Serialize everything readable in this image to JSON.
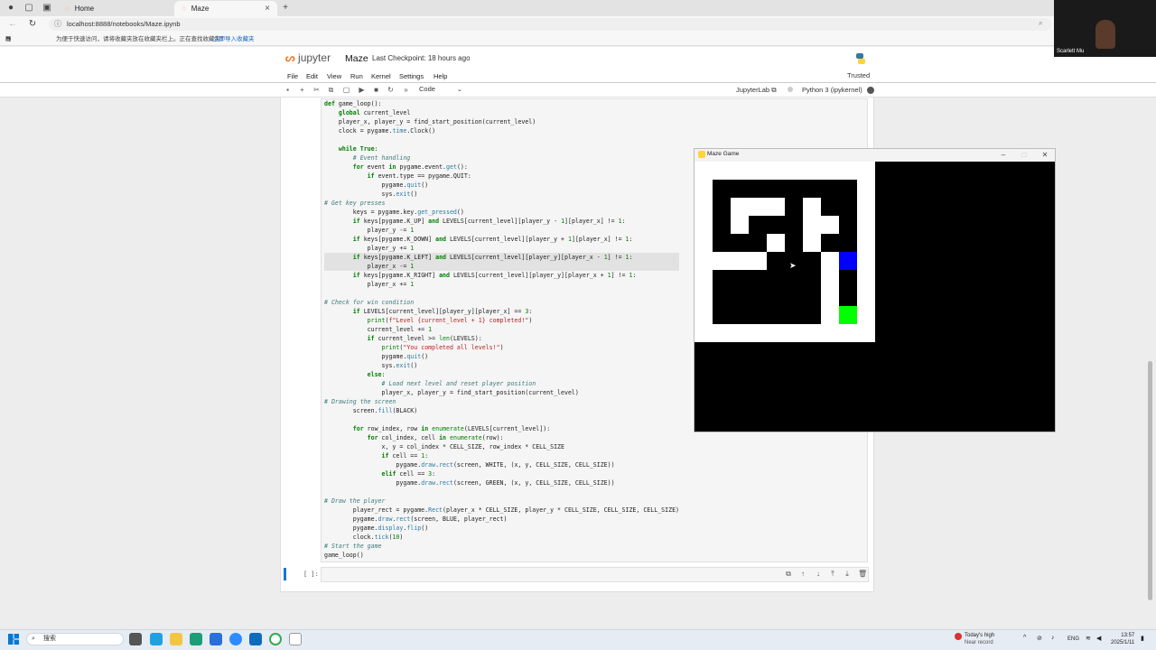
{
  "browser": {
    "tabs": [
      {
        "label": "Home"
      },
      {
        "label": "Maze"
      }
    ],
    "url": "localhost:8888/notebooks/Maze.ipynb",
    "bookmarks": {
      "import": "导入收藏夹",
      "hint": "为便于快速访问，请将收藏夹放在收藏夹栏上。正在查找收藏夹?",
      "link": "立即导入收藏夹"
    }
  },
  "jupyter": {
    "logo": "jupyter",
    "title": "Maze",
    "checkpoint": "Last Checkpoint: 18 hours ago",
    "trusted": "Trusted",
    "menu": [
      "File",
      "Edit",
      "View",
      "Run",
      "Kernel",
      "Settings",
      "Help"
    ],
    "cell_type": "Code",
    "jupyterlab": "JupyterLab",
    "kernel": "Python 3 (ipykernel)",
    "empty_prompt": "[ ]:"
  },
  "code_lines": [
    "def game_loop():",
    "    global current_level",
    "    player_x, player_y = find_start_position(current_level)",
    "    clock = pygame.time.Clock()",
    "",
    "    while True:",
    "        # Event handling",
    "        for event in pygame.event.get():",
    "            if event.type == pygame.QUIT:",
    "                pygame.quit()",
    "                sys.exit()",
    "# Get key presses",
    "        keys = pygame.key.get_pressed()",
    "        if keys[pygame.K_UP] and LEVELS[current_level][player_y - 1][player_x] != 1:",
    "            player_y -= 1",
    "        if keys[pygame.K_DOWN] and LEVELS[current_level][player_y + 1][player_x] != 1:",
    "            player_y += 1",
    "        if keys[pygame.K_LEFT] and LEVELS[current_level][player_y][player_x - 1] != 1:",
    "            player_x -= 1",
    "        if keys[pygame.K_RIGHT] and LEVELS[current_level][player_y][player_x + 1] != 1:",
    "            player_x += 1",
    "",
    "# Check for win condition",
    "        if LEVELS[current_level][player_y][player_x] == 3:",
    "            print(f\"Level {current_level + 1} completed!\")",
    "            current_level += 1",
    "            if current_level >= len(LEVELS):",
    "                print(\"You completed all levels!\")",
    "                pygame.quit()",
    "                sys.exit()",
    "            else:",
    "                # Load next level and reset player position",
    "                player_x, player_y = find_start_position(current_level)",
    "# Drawing the screen",
    "        screen.fill(BLACK)",
    "",
    "        for row_index, row in enumerate(LEVELS[current_level]):",
    "            for col_index, cell in enumerate(row):",
    "                x, y = col_index * CELL_SIZE, row_index * CELL_SIZE",
    "                if cell == 1:",
    "                    pygame.draw.rect(screen, WHITE, (x, y, CELL_SIZE, CELL_SIZE))",
    "                elif cell == 3:",
    "                    pygame.draw.rect(screen, GREEN, (x, y, CELL_SIZE, CELL_SIZE))",
    "",
    "# Draw the player",
    "        player_rect = pygame.Rect(player_x * CELL_SIZE, player_y * CELL_SIZE, CELL_SIZE, CELL_SIZE)",
    "        pygame.draw.rect(screen, BLUE, player_rect)",
    "        pygame.display.flip()",
    "        clock.tick(10)",
    "# Start the game",
    "game_loop()"
  ],
  "highlighted_lines": [
    17,
    18
  ],
  "game_window": {
    "title": "Maze Game",
    "grid": [
      "1111111111",
      "1000000001",
      "1011101001",
      "1010001101",
      "1000101001",
      "1111000121",
      "1000000101",
      "1000000101",
      "1000000131",
      "1111111111"
    ],
    "colors": {
      "wall": "#ffffff",
      "path": "#000000",
      "player": "#0000ff",
      "goal": "#00ff00"
    }
  },
  "video_overlay": {
    "name": "Scarlett Mu"
  },
  "taskbar": {
    "search": "搜索",
    "weather_title": "Today's high",
    "weather_sub": "Near record",
    "lang": "ENG",
    "time": "13:57",
    "date": "2025/1/11"
  }
}
